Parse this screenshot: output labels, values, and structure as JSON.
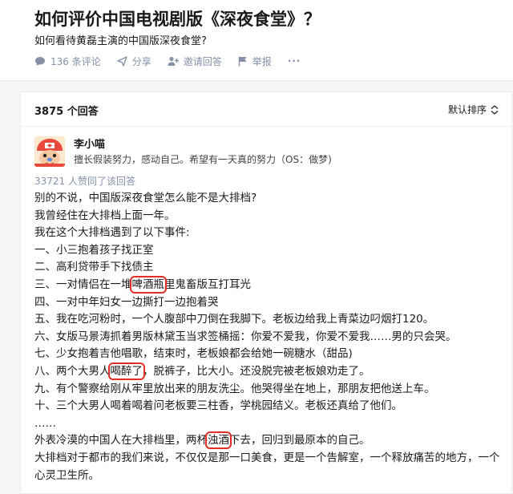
{
  "question": {
    "title": "如何评价中国电视剧版《深夜食堂》？",
    "description": "如何看待黄磊主演的中国版深夜食堂?",
    "actions": {
      "comments": "136 条评论",
      "share": "分享",
      "invite": "邀请回答",
      "report": "举报",
      "more": "···"
    }
  },
  "answers": {
    "count": "3875 个回答",
    "sort": "默认排序"
  },
  "answer": {
    "author": "李小喵",
    "bio": "擅长假装努力，感动自己。希望有一天真的努力（OS：做梦)",
    "votes": "33721 人赞同了该回答",
    "lines": [
      {
        "text": "别的不说，中国版深夜食堂怎么能不是大排档?"
      },
      {
        "text": "我曾经住在大排档上面一年。"
      },
      {
        "text": "我在这个大排档遇到了以下事件:"
      },
      {
        "text": "一、小三抱着孩子找正室"
      },
      {
        "text": "二、高利贷带手下找债主"
      },
      {
        "pre": "三、一对情侣在一堆",
        "hl": "啤酒瓶",
        "post": "里鬼畜版互打耳光"
      },
      {
        "text": "四、一对中年妇女一边撕打一边抱着哭"
      },
      {
        "text": "五、我在吃河粉时，一个人腹部中刀倒在我脚下。老板边给我上青菜边叼烟打120。"
      },
      {
        "text": "六、女版马景涛抓着男版林黛玉当求签桶摇：你爱不爱我，你爱不爱我……男的只会哭。"
      },
      {
        "text": "七、少女抱着吉他唱歌，结束时，老板娘都会给她一碗糖水（甜品)"
      },
      {
        "pre": "八、两个大男人",
        "hl": "喝醉了",
        "post": "，脱裤子，比大小。还没脱完被老板娘劝走了。"
      },
      {
        "text": "九、有个警察给刚从牢里放出来的朋友洗尘。他哭得坐在地上，那朋友把他送上车。"
      },
      {
        "text": "十、三个大男人喝着喝着问老板要三柱香，学桃园结义。老板还真给了他们。"
      },
      {
        "text": "……"
      },
      {
        "pre": "外表冷漠的中国人在大排档里，两杯",
        "hl": "浊酒",
        "post": "下去，回归到最原本的自己。"
      },
      {
        "text": "大排档对于都市的我们来说，不仅仅是那一口美食，更是一个告解室，一个释放痛苦的地方，一个"
      },
      {
        "text": "心灵卫生所。"
      }
    ]
  },
  "colors": {
    "highlight": "#e32d27",
    "meta": "#8590a6"
  }
}
